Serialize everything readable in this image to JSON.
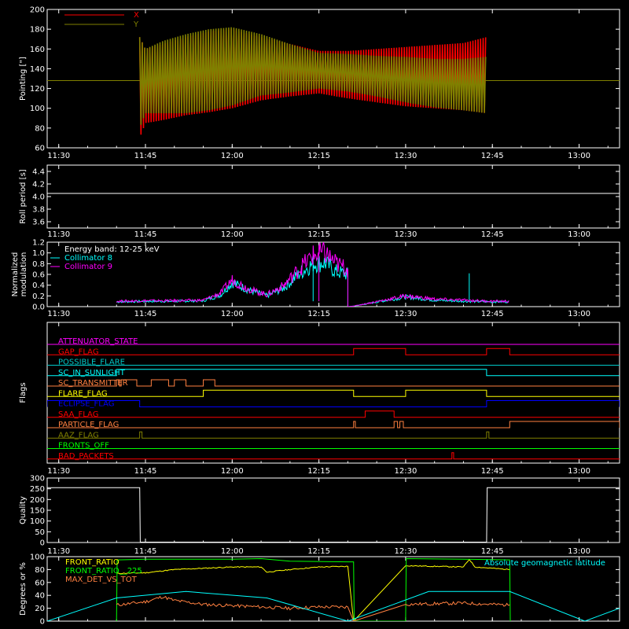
{
  "chart_data": [
    {
      "type": "line",
      "ylabel": "Pointing [\"]",
      "ylim": [
        60,
        200
      ],
      "yticks": [
        "60",
        "80",
        "100",
        "120",
        "140",
        "160",
        "180",
        "200"
      ],
      "xticks": [
        "11:30",
        "11:45",
        "12:00",
        "12:15",
        "12:30",
        "12:45",
        "13:00"
      ],
      "xlim_minutes": [
        0,
        95
      ],
      "legend_placement": "top-left",
      "legend": [
        {
          "name": "X",
          "color": "#ff0000"
        },
        {
          "name": "Y",
          "color": "#808000"
        }
      ],
      "reference_line": {
        "y": 128,
        "color": "#808000"
      },
      "series": [
        {
          "name": "X",
          "color": "#ff0000",
          "x": [
            "11:44",
            "11:45",
            "11:48",
            "11:52",
            "11:56",
            "12:00",
            "12:05",
            "12:10",
            "12:15",
            "12:20",
            "12:25",
            "12:30",
            "12:35",
            "12:40",
            "12:44"
          ],
          "y_max": [
            172,
            160,
            165,
            172,
            178,
            180,
            172,
            165,
            158,
            158,
            160,
            162,
            164,
            166,
            172
          ],
          "y_min": [
            70,
            85,
            88,
            93,
            96,
            100,
            108,
            112,
            115,
            110,
            106,
            102,
            100,
            98,
            95
          ]
        },
        {
          "name": "Y",
          "color": "#808000",
          "x": [
            "11:44",
            "11:45",
            "11:48",
            "11:52",
            "11:56",
            "12:00",
            "12:05",
            "12:10",
            "12:15",
            "12:20",
            "12:25",
            "12:30",
            "12:35",
            "12:40",
            "12:44"
          ],
          "y_max": [
            172,
            160,
            168,
            175,
            180,
            182,
            175,
            165,
            156,
            155,
            153,
            152,
            150,
            150,
            152
          ],
          "y_min": [
            80,
            95,
            95,
            95,
            98,
            103,
            113,
            116,
            120,
            117,
            112,
            106,
            101,
            98,
            95
          ]
        }
      ]
    },
    {
      "type": "line",
      "ylabel": "Roll period [s]",
      "ylim": [
        3.5,
        4.5
      ],
      "yticks": [
        "3.6",
        "3.8",
        "4.0",
        "4.2",
        "4.4"
      ],
      "xticks": [
        "11:30",
        "11:45",
        "12:00",
        "12:15",
        "12:30",
        "12:45",
        "13:00"
      ],
      "series": [
        {
          "name": "",
          "color": "#ffffff",
          "x": [
            "11:28",
            "13:07"
          ],
          "y": [
            4.05,
            4.05
          ]
        }
      ]
    },
    {
      "type": "line",
      "ylabel": "Normalized modulation",
      "ylim": [
        0,
        1.2
      ],
      "yticks": [
        "0.0",
        "0.2",
        "0.4",
        "0.6",
        "0.8",
        "1.0",
        "1.2"
      ],
      "xticks": [
        "11:30",
        "11:45",
        "12:00",
        "12:15",
        "12:30",
        "12:45",
        "13:00"
      ],
      "legend": [
        {
          "name": "Energy band: 12-25 keV",
          "color": "#ffffff"
        },
        {
          "name": "Collimator 8",
          "color": "#00ffff"
        },
        {
          "name": "Collimator 9",
          "color": "#ff00ff"
        }
      ],
      "series": [
        {
          "name": "Collimator 8",
          "color": "#00ffff",
          "x": [
            "11:40",
            "11:45",
            "11:50",
            "11:55",
            "11:58",
            "12:00",
            "12:03",
            "12:06",
            "12:09",
            "12:12",
            "12:14",
            "12:16",
            "12:18",
            "12:20",
            "12:21",
            "12:30",
            "12:35",
            "12:40",
            "12:45",
            "12:48"
          ],
          "y": [
            0.09,
            0.1,
            0.1,
            0.11,
            0.22,
            0.45,
            0.3,
            0.2,
            0.35,
            0.65,
            0.8,
            0.82,
            0.65,
            0.6,
            0.01,
            0.18,
            0.12,
            0.1,
            0.09,
            0.09
          ],
          "spikes": [
            {
              "x": "12:14",
              "y": 0.95
            },
            {
              "x": "12:41",
              "y": 0.62
            }
          ]
        },
        {
          "name": "Collimator 9",
          "color": "#ff00ff",
          "x": [
            "11:40",
            "11:45",
            "11:50",
            "11:55",
            "11:58",
            "12:00",
            "12:03",
            "12:06",
            "12:09",
            "12:12",
            "12:14",
            "12:16",
            "12:18",
            "12:20",
            "12:21",
            "12:30",
            "12:35",
            "12:40",
            "12:45",
            "12:48"
          ],
          "y": [
            0.1,
            0.11,
            0.11,
            0.12,
            0.25,
            0.5,
            0.32,
            0.22,
            0.4,
            0.75,
            0.95,
            1.0,
            0.8,
            0.7,
            0.01,
            0.2,
            0.14,
            0.12,
            0.1,
            0.1
          ],
          "spikes": [
            {
              "x": "12:15",
              "y": 1.15
            }
          ]
        }
      ]
    },
    {
      "type": "line",
      "ylabel": "Flags",
      "xticks": [
        "11:30",
        "11:45",
        "12:00",
        "12:15",
        "12:30",
        "12:45",
        "13:00"
      ],
      "flags": [
        {
          "name": "ATTENUATOR_STATE",
          "color": "#ff00ff",
          "segments": []
        },
        {
          "name": "GAP_FLAG",
          "color": "#ff0000",
          "segments": [
            [
              "12:21",
              "12:30"
            ],
            [
              "12:44",
              "12:48"
            ]
          ]
        },
        {
          "name": "POSSIBLE_FLARE",
          "color": "#00c8c8",
          "segments": []
        },
        {
          "name": "SC_IN_SUNLIGHT",
          "color": "#00ffff",
          "segments": [
            [
              "11:40",
              "12:44"
            ]
          ]
        },
        {
          "name": "SC_TRANSMITTER",
          "color": "#ff8040",
          "segments": [
            [
              "11:40",
              "11:40.5"
            ],
            [
              "11:40.8",
              "11:43.5"
            ],
            [
              "11:46",
              "11:49"
            ],
            [
              "11:50",
              "11:52"
            ],
            [
              "11:55",
              "11:57"
            ]
          ]
        },
        {
          "name": "FLARE_FLAG",
          "color": "#ffff00",
          "segments": [
            [
              "11:55",
              "12:21"
            ],
            [
              "12:30",
              "12:44"
            ]
          ]
        },
        {
          "name": "ECLIPSE_FLAG",
          "color": "#0000ff",
          "segments": [
            [
              "11:28",
              "11:44"
            ],
            [
              "12:44",
              "13:07"
            ]
          ]
        },
        {
          "name": "SAA_FLAG",
          "color": "#ff0000",
          "segments": [
            [
              "12:23",
              "12:28"
            ]
          ]
        },
        {
          "name": "PARTICLE_FLAG",
          "color": "#ff8040",
          "segments": [
            [
              "12:21",
              "12:21.3"
            ],
            [
              "12:28",
              "12:28.6"
            ],
            [
              "12:29",
              "12:29.6"
            ],
            [
              "12:48",
              "13:07"
            ]
          ]
        },
        {
          "name": "AAZ_FLAG",
          "color": "#808000",
          "segments": [
            [
              "11:44",
              "11:44.4"
            ],
            [
              "12:44",
              "12:44.4"
            ]
          ]
        },
        {
          "name": "FRONTS_OFF",
          "color": "#00ff00",
          "segments": []
        },
        {
          "name": "BAD_PACKETS",
          "color": "#ff0000",
          "segments": [
            [
              "12:38",
              "12:38.3"
            ]
          ]
        }
      ]
    },
    {
      "type": "line",
      "ylabel": "Quality",
      "ylim": [
        0,
        300
      ],
      "yticks": [
        "0",
        "50",
        "100",
        "150",
        "200",
        "250",
        "300"
      ],
      "xticks": [
        "11:30",
        "11:45",
        "12:00",
        "12:15",
        "12:30",
        "12:45",
        "13:00"
      ],
      "series": [
        {
          "name": "",
          "color": "#ffffff",
          "x": [
            "11:28",
            "11:44",
            "11:44.1",
            "12:44",
            "12:44.1",
            "13:07"
          ],
          "y": [
            255,
            255,
            2,
            2,
            255,
            255
          ]
        }
      ]
    },
    {
      "type": "line",
      "ylabel": "Degrees or %",
      "ylim": [
        0,
        100
      ],
      "yticks": [
        "0",
        "20",
        "40",
        "60",
        "80",
        "100"
      ],
      "xticks": [
        "11:30",
        "11:45",
        "12:00",
        "12:15",
        "12:30",
        "12:45",
        "13:00"
      ],
      "legend": [
        {
          "name": "FRONT_RATIO",
          "color": "#ffff00"
        },
        {
          "name": "FRONT_RATIO__225",
          "color": "#00ff00"
        },
        {
          "name": "MAX_DET_VS_TOT",
          "color": "#ff8040"
        },
        {
          "name": "Absolute geomagnetic latitude",
          "color": "#00ffff"
        }
      ],
      "series": [
        {
          "name": "FRONT_RATIO",
          "color": "#ffff00",
          "x": [
            "11:40",
            "11:45",
            "11:50",
            "12:00",
            "12:05",
            "12:06",
            "12:10",
            "12:15",
            "12:20",
            "12:21",
            "12:30",
            "12:35",
            "12:40",
            "12:41",
            "12:42",
            "12:45",
            "12:48"
          ],
          "y": [
            74,
            75,
            80,
            84,
            84,
            76,
            80,
            84,
            85,
            0,
            86,
            85,
            84,
            96,
            84,
            82,
            80
          ]
        },
        {
          "name": "FRONT_RATIO__225",
          "color": "#00ff00",
          "x": [
            "11:40",
            "11:40.1",
            "11:45",
            "12:00",
            "12:05",
            "12:10",
            "12:20",
            "12:21",
            "12:21.1",
            "12:30",
            "12:30.1",
            "12:40",
            "12:48",
            "12:48.1"
          ],
          "y": [
            0,
            95,
            96,
            96,
            97,
            93,
            92,
            92,
            0,
            0,
            97,
            96,
            95,
            0
          ]
        },
        {
          "name": "MAX_DET_VS_TOT",
          "color": "#ff8040",
          "x": [
            "11:40",
            "11:45",
            "11:48",
            "11:50",
            "11:55",
            "12:00",
            "12:05",
            "12:10",
            "12:15",
            "12:20",
            "12:21",
            "12:30",
            "12:35",
            "12:40",
            "12:45",
            "12:48"
          ],
          "y": [
            25,
            30,
            38,
            32,
            26,
            24,
            22,
            20,
            22,
            22,
            0,
            26,
            27,
            28,
            26,
            25
          ]
        },
        {
          "name": "Absolute geomagnetic latitude",
          "color": "#00ffff",
          "x": [
            "11:28",
            "11:40",
            "11:52",
            "12:06",
            "12:20",
            "12:34",
            "12:48",
            "13:01",
            "13:07"
          ],
          "y": [
            0,
            36,
            46,
            36,
            0,
            46,
            46,
            0,
            20
          ]
        }
      ]
    }
  ]
}
